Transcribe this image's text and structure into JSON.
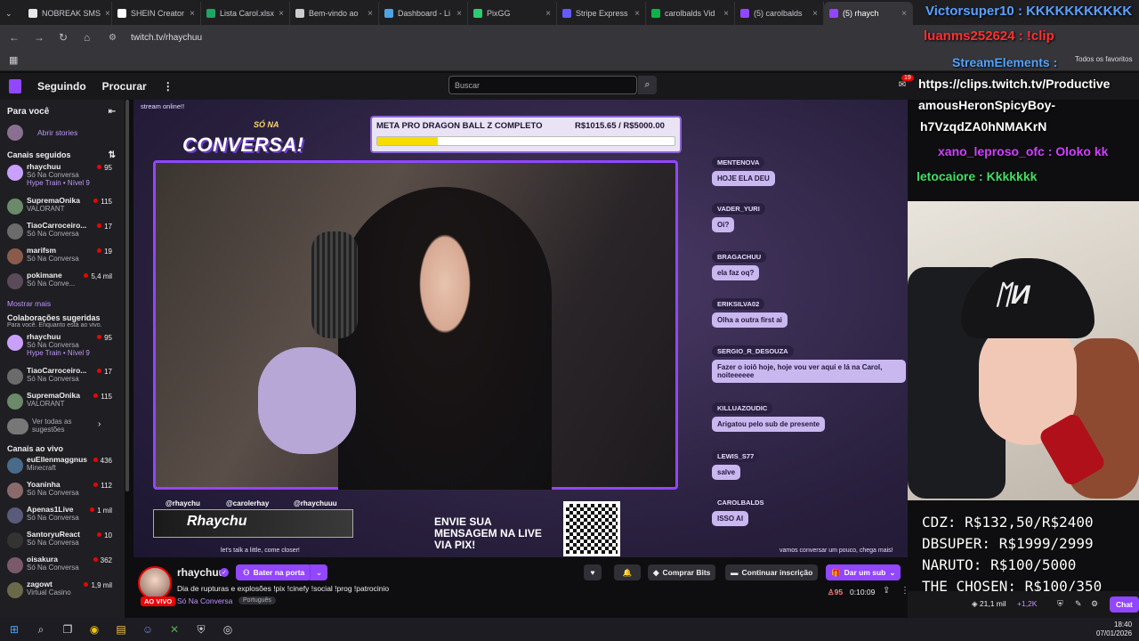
{
  "browser": {
    "tabs": [
      {
        "label": "NOBREAK SMS",
        "color": "#e8e8e8"
      },
      {
        "label": "SHEIN Creator",
        "color": "#ffffff"
      },
      {
        "label": "Lista Carol.xlsx",
        "color": "#1fa463"
      },
      {
        "label": "Bem-vindo ao",
        "color": "#cccccc"
      },
      {
        "label": "Dashboard - Li",
        "color": "#4fa3e0"
      },
      {
        "label": "PixGG",
        "color": "#2ecc71"
      },
      {
        "label": "Stripe Express",
        "color": "#635bff"
      },
      {
        "label": "carolbalds Vid",
        "color": "#0fb24a"
      },
      {
        "label": "(5) carolbalds",
        "color": "#9146ff"
      },
      {
        "label": "(5) rhaych",
        "color": "#9146ff"
      }
    ],
    "url": "twitch.tv/rhaychuu",
    "favorites": "Todos os favoritos"
  },
  "twitch": {
    "nav": {
      "following": "Seguindo",
      "browse": "Procurar",
      "search_placeholder": "Buscar",
      "notif_count": "19"
    },
    "sidebar": {
      "for_you": "Para você",
      "open_stories": "Abrir stories",
      "followed_header": "Canais seguidos",
      "followed": [
        {
          "name": "rhaychuu",
          "game": "Só Na Conversa",
          "extra": "Hype Train • Nível 9",
          "viewers": "95",
          "color": "#c9a0ff"
        },
        {
          "name": "SupremaOnika",
          "game": "VALORANT",
          "extra": "",
          "viewers": "115",
          "color": "#6a8a6a"
        },
        {
          "name": "TiaoCarroceiro...",
          "game": "Só Na Conversa",
          "extra": "",
          "viewers": "17",
          "color": "#6b6b6b"
        },
        {
          "name": "marifsm",
          "game": "Só Na Conversa",
          "extra": "",
          "viewers": "19",
          "color": "#8a5a4a"
        },
        {
          "name": "pokimane",
          "game": "Só Na Conve...",
          "extra": "",
          "viewers": "5,4 mil",
          "color": "#5a4a5a"
        }
      ],
      "show_more": "Mostrar mais",
      "suggested_header": "Colaborações sugeridas",
      "suggested_sub": "Para você. Enquanto está ao vivo.",
      "suggested": [
        {
          "name": "rhaychuu",
          "game": "Só Na Conversa",
          "extra": "Hype Train • Nível 9",
          "viewers": "95",
          "color": "#c9a0ff"
        },
        {
          "name": "TiaoCarroceiro...",
          "game": "Só Na Conversa",
          "extra": "",
          "viewers": "17",
          "color": "#6b6b6b"
        },
        {
          "name": "SupremaOnika",
          "game": "VALORANT",
          "extra": "",
          "viewers": "115",
          "color": "#6a8a6a"
        }
      ],
      "see_all": "Ver todas as sugestões",
      "live_header": "Canais ao vivo",
      "live": [
        {
          "name": "euEllenmaggnus",
          "game": "Minecraft",
          "viewers": "436",
          "color": "#4a6a8a"
        },
        {
          "name": "Yoaninha",
          "game": "Só Na Conversa",
          "viewers": "112",
          "color": "#8a6a6a"
        },
        {
          "name": "Apenas1Live",
          "game": "Só Na Conversa",
          "viewers": "1 mil",
          "color": "#5a5a7a"
        },
        {
          "name": "SantoryuReact",
          "game": "Só Na Conversa",
          "viewers": "10",
          "color": "#333"
        },
        {
          "name": "oisakura",
          "game": "Só Na Conversa",
          "viewers": "362",
          "color": "#7a5a6a"
        },
        {
          "name": "zagowt",
          "game": "Virtual Casino",
          "viewers": "1,9 mil",
          "color": "#6a6a4a"
        }
      ]
    },
    "stream": {
      "online": "stream online!!",
      "logo_small": "SÓ NA",
      "logo": "CONVERSA!",
      "goal_label": "META PRO DRAGON BALL Z COMPLETO",
      "goal_value": "R$1015.65 / R$5000.00",
      "goal_fraction": 0.203,
      "socials": [
        "@rhaychu",
        "@carolerhay",
        "@rhaychuuu"
      ],
      "banner": "Rhaychu",
      "pix": "ENVIE SUA MENSAGEM NA LIVE VIA PIX!",
      "footer_left": "let's talk a little, come closer!",
      "footer_right": "vamos conversar um pouco, chega mais!",
      "overlay_chat": [
        {
          "name": "MENTENOVA",
          "msg": "HOJE ELA DEU"
        },
        {
          "name": "VADER_YURI",
          "msg": "Oi?"
        },
        {
          "name": "BRAGACHUU",
          "msg": "ela faz oq?"
        },
        {
          "name": "ERIKSILVA02",
          "msg": "Olha a outra first ai"
        },
        {
          "name": "SERGIO_R_DESOUZA",
          "msg": "Fazer o ioiô hoje, hoje vou ver aqui e lá na Carol, noiteeeeee"
        },
        {
          "name": "KILLUAZOUDIC",
          "msg": "Arigatou pelo sub de presente"
        },
        {
          "name": "LEWIS_S77",
          "msg": "salve"
        },
        {
          "name": "CAROLBALDS",
          "msg": "ISSO AI"
        }
      ]
    },
    "info": {
      "streamer": "rhaychuu",
      "live_badge": "AO VIVO",
      "knock": "Bater na porta",
      "title": "Dia de rupturas e explosões !pix !cinefy !social !prog !patrocinio",
      "category": "Só Na Conversa",
      "language": "Português",
      "buy_bits": "Comprar Bits",
      "continue_sub": "Continuar inscrição",
      "gift_sub": "Dar um sub",
      "viewers": "95",
      "uptime": "0:10:09"
    },
    "chat": {
      "points": "21,1 mil",
      "bonus": "+1,2K",
      "chat_button": "Chat"
    }
  },
  "obs_overlay": {
    "chat_lines": [
      {
        "text": "Victorsuper10 : KKKKKKKKKKK",
        "color": "#5aa0ff"
      },
      {
        "text": "luanms252624 : !clip",
        "color": "#ff3030"
      },
      {
        "text": "StreamElements :",
        "color": "#4fa3ff"
      },
      {
        "text": "https://clips.twitch.tv/Productive",
        "color": "#ffffff"
      },
      {
        "text": "amousHeronSpicyBoy-",
        "color": "#ffffff"
      },
      {
        "text": "h7VzqdZA0hNMAKrN",
        "color": "#ffffff"
      },
      {
        "text": "xano_leproso_ofc : Oloko kk",
        "color": "#d040ff"
      },
      {
        "text": "letocaiore : Kkkkkkk",
        "color": "#40e060"
      }
    ],
    "prices": [
      "CDZ: R$132,50/R$2400",
      "DBSUPER: R$1999/2999",
      "NARUTO: R$100/5000",
      "THE CHOSEN: R$100/350"
    ]
  },
  "taskbar": {
    "time": "18:40",
    "date": "07/01/2026"
  }
}
